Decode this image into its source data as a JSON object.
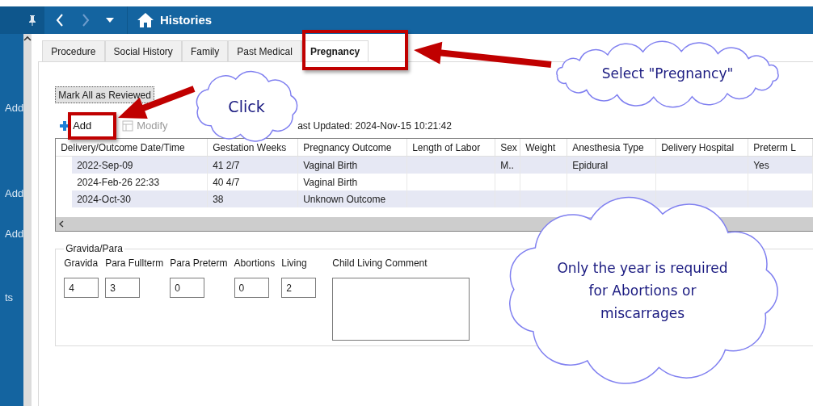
{
  "window": {
    "title": "Histories"
  },
  "sidebar": {
    "items": [
      "Add",
      "Add",
      "Add",
      "ts"
    ]
  },
  "tabs": [
    {
      "label": "Procedure",
      "selected": false
    },
    {
      "label": "Social History",
      "selected": false
    },
    {
      "label": "Family",
      "selected": false
    },
    {
      "label": "Past Medical",
      "selected": false
    },
    {
      "label": "Pregnancy",
      "selected": true
    }
  ],
  "review_button": "Mark All as Reviewed",
  "toolbar": [
    {
      "kind": "add",
      "label": "Add",
      "disabled": false
    },
    {
      "kind": "modify",
      "label": "Modify",
      "disabled": true
    }
  ],
  "last_updated": "ast Updated: 2024-Nov-15 10:21:42",
  "table": {
    "columns": [
      "Delivery/Outcome Date/Time",
      "Gestation Weeks",
      "Pregnancy Outcome",
      "Length of Labor",
      "Sex",
      "Weight",
      "Anesthesia Type",
      "Delivery Hospital",
      "Preterm L"
    ],
    "rows": [
      [
        "2022-Sep-09",
        "41 2/7",
        "Vaginal Birth",
        null,
        "M..",
        null,
        "Epidural",
        null,
        "Yes"
      ],
      [
        "2024-Feb-26 22:33",
        "40 4/7",
        "Vaginal Birth",
        null,
        null,
        null,
        null,
        null,
        null
      ],
      [
        "2024-Oct-30",
        "38",
        "Unknown Outcome",
        null,
        null,
        null,
        null,
        null,
        null
      ]
    ]
  },
  "gravida_para": {
    "title": "Gravida/Para",
    "fields": [
      {
        "label": "Gravida",
        "value": "4"
      },
      {
        "label": "Para Fullterm",
        "value": "3"
      },
      {
        "label": "Para Preterm",
        "value": "0"
      },
      {
        "label": "Abortions",
        "value": "0"
      },
      {
        "label": "Living",
        "value": "2"
      }
    ],
    "comment": {
      "label": "Child Living Comment"
    }
  },
  "callouts": [
    {
      "text": "Click"
    },
    {
      "text": "Select \"Pregnancy\""
    },
    {
      "text": "Only the year is required for Abortions or miscarrages"
    }
  ]
}
